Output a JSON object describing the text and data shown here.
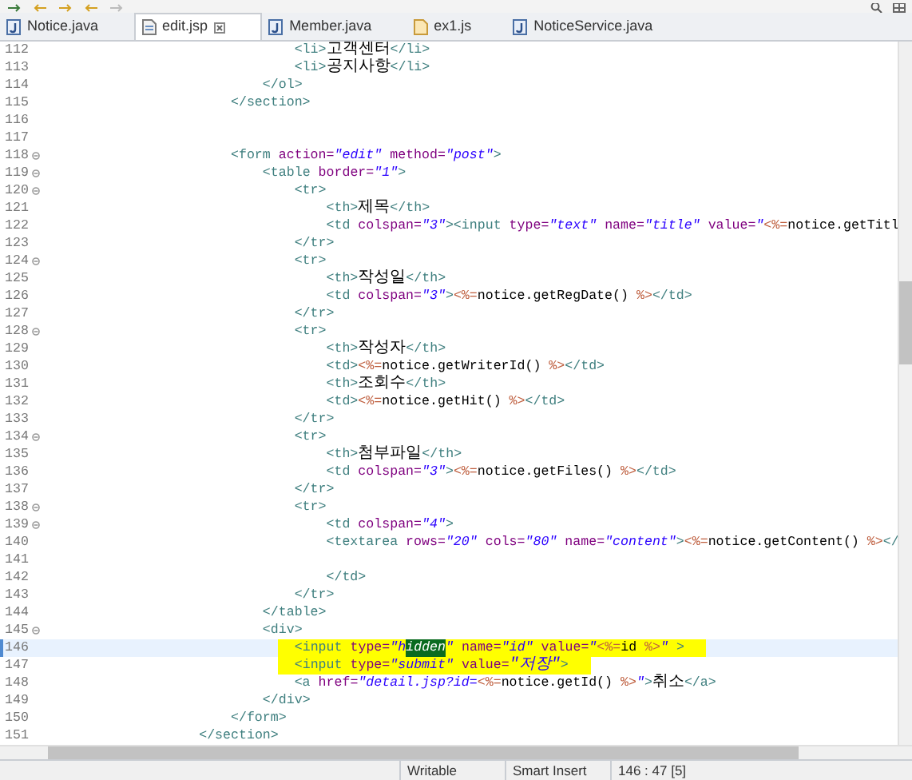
{
  "tabs": [
    {
      "label": "Notice.java",
      "kind": "java",
      "selected": false
    },
    {
      "label": "edit.jsp",
      "kind": "jsp",
      "selected": true
    },
    {
      "label": "Member.java",
      "kind": "java",
      "selected": false
    },
    {
      "label": "ex1.js",
      "kind": "js",
      "selected": false
    },
    {
      "label": "NoticeService.java",
      "kind": "java",
      "selected": false
    }
  ],
  "editor": {
    "lines": [
      {
        "number": "112",
        "fold": false,
        "current": false,
        "marked": false,
        "tokens": [
          {
            "kind": "tag",
            "text": "                                <li>"
          },
          {
            "kind": "text",
            "text": "고객센터"
          },
          {
            "kind": "tag",
            "text": "</li>"
          }
        ]
      },
      {
        "number": "113",
        "fold": false,
        "current": false,
        "marked": false,
        "tokens": [
          {
            "kind": "tag",
            "text": "                                <li>"
          },
          {
            "kind": "text",
            "text": "공지사항"
          },
          {
            "kind": "tag",
            "text": "</li>"
          }
        ]
      },
      {
        "number": "114",
        "fold": false,
        "current": false,
        "marked": false,
        "tokens": [
          {
            "kind": "tag",
            "text": "                            </ol>"
          }
        ]
      },
      {
        "number": "115",
        "fold": false,
        "current": false,
        "marked": false,
        "tokens": [
          {
            "kind": "tag",
            "text": "                        </section>"
          }
        ]
      },
      {
        "number": "116",
        "fold": false,
        "current": false,
        "marked": false
      },
      {
        "number": "117",
        "fold": false,
        "current": false,
        "marked": false
      },
      {
        "number": "118",
        "fold": true,
        "current": false,
        "marked": false,
        "tokens": [
          {
            "kind": "tag",
            "text": "                        <form"
          },
          {
            "kind": "attr",
            "text": " action="
          },
          {
            "kind": "str",
            "text": "\"edit\""
          },
          {
            "kind": "attr",
            "text": " method="
          },
          {
            "kind": "str",
            "text": "\"post\""
          },
          {
            "kind": "tag",
            "text": ">"
          }
        ]
      },
      {
        "number": "119",
        "fold": true,
        "current": false,
        "marked": false,
        "tokens": [
          {
            "kind": "tag",
            "text": "                            <table"
          },
          {
            "kind": "attr",
            "text": " border="
          },
          {
            "kind": "str",
            "text": "\"1\""
          },
          {
            "kind": "tag",
            "text": ">"
          }
        ]
      },
      {
        "number": "120",
        "fold": true,
        "current": false,
        "marked": false,
        "tokens": [
          {
            "kind": "tag",
            "text": "                                <tr>"
          }
        ]
      },
      {
        "number": "121",
        "fold": false,
        "current": false,
        "marked": false,
        "tokens": [
          {
            "kind": "tag",
            "text": "                                    <th>"
          },
          {
            "kind": "text",
            "text": "제목"
          },
          {
            "kind": "tag",
            "text": "</th>"
          }
        ]
      },
      {
        "number": "122",
        "fold": false,
        "current": false,
        "marked": false,
        "tokens": [
          {
            "kind": "tag",
            "text": "                                    <td"
          },
          {
            "kind": "attr",
            "text": " colspan="
          },
          {
            "kind": "str",
            "text": "\"3\""
          },
          {
            "kind": "tag",
            "text": "><input"
          },
          {
            "kind": "attr",
            "text": " type="
          },
          {
            "kind": "str",
            "text": "\"text\""
          },
          {
            "kind": "attr",
            "text": " name="
          },
          {
            "kind": "str",
            "text": "\"title\""
          },
          {
            "kind": "attr",
            "text": " value="
          },
          {
            "kind": "str",
            "text": "\""
          },
          {
            "kind": "jsp",
            "text": "<%="
          },
          {
            "kind": "text",
            "text": "notice.getTitl"
          }
        ]
      },
      {
        "number": "123",
        "fold": false,
        "current": false,
        "marked": false,
        "tokens": [
          {
            "kind": "tag",
            "text": "                                </tr>"
          }
        ]
      },
      {
        "number": "124",
        "fold": true,
        "current": false,
        "marked": false,
        "tokens": [
          {
            "kind": "tag",
            "text": "                                <tr>"
          }
        ]
      },
      {
        "number": "125",
        "fold": false,
        "current": false,
        "marked": false,
        "tokens": [
          {
            "kind": "tag",
            "text": "                                    <th>"
          },
          {
            "kind": "text",
            "text": "작성일"
          },
          {
            "kind": "tag",
            "text": "</th>"
          }
        ]
      },
      {
        "number": "126",
        "fold": false,
        "current": false,
        "marked": false,
        "tokens": [
          {
            "kind": "tag",
            "text": "                                    <td"
          },
          {
            "kind": "attr",
            "text": " colspan="
          },
          {
            "kind": "str",
            "text": "\"3\""
          },
          {
            "kind": "tag",
            "text": ">"
          },
          {
            "kind": "jsp",
            "text": "<%="
          },
          {
            "kind": "text",
            "text": "notice.getRegDate() "
          },
          {
            "kind": "jsp",
            "text": "%>"
          },
          {
            "kind": "tag",
            "text": "</td>"
          }
        ]
      },
      {
        "number": "127",
        "fold": false,
        "current": false,
        "marked": false,
        "tokens": [
          {
            "kind": "tag",
            "text": "                                </tr>"
          }
        ]
      },
      {
        "number": "128",
        "fold": true,
        "current": false,
        "marked": false,
        "tokens": [
          {
            "kind": "tag",
            "text": "                                <tr>"
          }
        ]
      },
      {
        "number": "129",
        "fold": false,
        "current": false,
        "marked": false,
        "tokens": [
          {
            "kind": "tag",
            "text": "                                    <th>"
          },
          {
            "kind": "text",
            "text": "작성자"
          },
          {
            "kind": "tag",
            "text": "</th>"
          }
        ]
      },
      {
        "number": "130",
        "fold": false,
        "current": false,
        "marked": false,
        "tokens": [
          {
            "kind": "tag",
            "text": "                                    <td>"
          },
          {
            "kind": "jsp",
            "text": "<%="
          },
          {
            "kind": "text",
            "text": "notice.getWriterId() "
          },
          {
            "kind": "jsp",
            "text": "%>"
          },
          {
            "kind": "tag",
            "text": "</td>"
          }
        ]
      },
      {
        "number": "131",
        "fold": false,
        "current": false,
        "marked": false,
        "tokens": [
          {
            "kind": "tag",
            "text": "                                    <th>"
          },
          {
            "kind": "text",
            "text": "조회수"
          },
          {
            "kind": "tag",
            "text": "</th>"
          }
        ]
      },
      {
        "number": "132",
        "fold": false,
        "current": false,
        "marked": false,
        "tokens": [
          {
            "kind": "tag",
            "text": "                                    <td>"
          },
          {
            "kind": "jsp",
            "text": "<%="
          },
          {
            "kind": "text",
            "text": "notice.getHit() "
          },
          {
            "kind": "jsp",
            "text": "%>"
          },
          {
            "kind": "tag",
            "text": "</td>"
          }
        ]
      },
      {
        "number": "133",
        "fold": false,
        "current": false,
        "marked": false,
        "tokens": [
          {
            "kind": "tag",
            "text": "                                </tr>"
          }
        ]
      },
      {
        "number": "134",
        "fold": true,
        "current": false,
        "marked": false,
        "tokens": [
          {
            "kind": "tag",
            "text": "                                <tr>"
          }
        ]
      },
      {
        "number": "135",
        "fold": false,
        "current": false,
        "marked": false,
        "tokens": [
          {
            "kind": "tag",
            "text": "                                    <th>"
          },
          {
            "kind": "text",
            "text": "첨부파일"
          },
          {
            "kind": "tag",
            "text": "</th>"
          }
        ]
      },
      {
        "number": "136",
        "fold": false,
        "current": false,
        "marked": false,
        "tokens": [
          {
            "kind": "tag",
            "text": "                                    <td"
          },
          {
            "kind": "attr",
            "text": " colspan="
          },
          {
            "kind": "str",
            "text": "\"3\""
          },
          {
            "kind": "tag",
            "text": ">"
          },
          {
            "kind": "jsp",
            "text": "<%="
          },
          {
            "kind": "text",
            "text": "notice.getFiles() "
          },
          {
            "kind": "jsp",
            "text": "%>"
          },
          {
            "kind": "tag",
            "text": "</td>"
          }
        ]
      },
      {
        "number": "137",
        "fold": false,
        "current": false,
        "marked": false,
        "tokens": [
          {
            "kind": "tag",
            "text": "                                </tr>"
          }
        ]
      },
      {
        "number": "138",
        "fold": true,
        "current": false,
        "marked": false,
        "tokens": [
          {
            "kind": "tag",
            "text": "                                <tr>"
          }
        ]
      },
      {
        "number": "139",
        "fold": true,
        "current": false,
        "marked": false,
        "tokens": [
          {
            "kind": "tag",
            "text": "                                    <td"
          },
          {
            "kind": "attr",
            "text": " colspan="
          },
          {
            "kind": "str",
            "text": "\"4\""
          },
          {
            "kind": "tag",
            "text": ">"
          }
        ]
      },
      {
        "number": "140",
        "fold": false,
        "current": false,
        "marked": false,
        "tokens": [
          {
            "kind": "tag",
            "text": "                                    <textarea"
          },
          {
            "kind": "attr",
            "text": " rows="
          },
          {
            "kind": "str",
            "text": "\"20\""
          },
          {
            "kind": "attr",
            "text": " cols="
          },
          {
            "kind": "str",
            "text": "\"80\""
          },
          {
            "kind": "attr",
            "text": " name="
          },
          {
            "kind": "str",
            "text": "\"content\""
          },
          {
            "kind": "tag",
            "text": ">"
          },
          {
            "kind": "jsp",
            "text": "<%="
          },
          {
            "kind": "text",
            "text": "notice.getContent() "
          },
          {
            "kind": "jsp",
            "text": "%>"
          },
          {
            "kind": "tag",
            "text": "</"
          }
        ]
      },
      {
        "number": "141",
        "fold": false,
        "current": false,
        "marked": false
      },
      {
        "number": "142",
        "fold": false,
        "current": false,
        "marked": false,
        "tokens": [
          {
            "kind": "tag",
            "text": "                                    </td>"
          }
        ]
      },
      {
        "number": "143",
        "fold": false,
        "current": false,
        "marked": false,
        "tokens": [
          {
            "kind": "tag",
            "text": "                                </tr>"
          }
        ]
      },
      {
        "number": "144",
        "fold": false,
        "current": false,
        "marked": false,
        "tokens": [
          {
            "kind": "tag",
            "text": "                            </table>"
          }
        ]
      },
      {
        "number": "145",
        "fold": true,
        "current": false,
        "marked": false,
        "tokens": [
          {
            "kind": "tag",
            "text": "                            <div>"
          }
        ]
      },
      {
        "number": "146",
        "fold": false,
        "current": true,
        "marked": true,
        "tokens": [
          {
            "kind": "tag",
            "text": "                                <input"
          },
          {
            "kind": "attr",
            "text": " type="
          },
          {
            "kind": "str",
            "text": "\"h"
          },
          {
            "kind": "selected",
            "text": "idden"
          },
          {
            "kind": "str",
            "text": "\""
          },
          {
            "kind": "attr",
            "text": " name="
          },
          {
            "kind": "str",
            "text": "\"id\""
          },
          {
            "kind": "attr",
            "text": " value="
          },
          {
            "kind": "str",
            "text": "\""
          },
          {
            "kind": "jsp",
            "text": "<%="
          },
          {
            "kind": "text",
            "text": "id "
          },
          {
            "kind": "jsp",
            "text": "%>"
          },
          {
            "kind": "str",
            "text": "\""
          },
          {
            "kind": "tag",
            "text": " >"
          }
        ]
      },
      {
        "number": "147",
        "fold": false,
        "current": false,
        "marked": true,
        "tokens": [
          {
            "kind": "tag",
            "text": "                                <input"
          },
          {
            "kind": "attr",
            "text": " type="
          },
          {
            "kind": "str",
            "text": "\"submit\""
          },
          {
            "kind": "attr",
            "text": " value="
          },
          {
            "kind": "str",
            "text": "\"저장\""
          },
          {
            "kind": "tag",
            "text": ">"
          }
        ]
      },
      {
        "number": "148",
        "fold": false,
        "current": false,
        "marked": false,
        "tokens": [
          {
            "kind": "tag",
            "text": "                                <a"
          },
          {
            "kind": "attr",
            "text": " href="
          },
          {
            "kind": "str",
            "text": "\"detail.jsp?id="
          },
          {
            "kind": "jsp",
            "text": "<%="
          },
          {
            "kind": "text",
            "text": "notice.getId() "
          },
          {
            "kind": "jsp",
            "text": "%>"
          },
          {
            "kind": "str",
            "text": "\""
          },
          {
            "kind": "tag",
            "text": ">"
          },
          {
            "kind": "text",
            "text": "취소"
          },
          {
            "kind": "tag",
            "text": "</a>"
          }
        ]
      },
      {
        "number": "149",
        "fold": false,
        "current": false,
        "marked": false,
        "tokens": [
          {
            "kind": "tag",
            "text": "                            </div>"
          }
        ]
      },
      {
        "number": "150",
        "fold": false,
        "current": false,
        "marked": false,
        "tokens": [
          {
            "kind": "tag",
            "text": "                        </form>"
          }
        ]
      },
      {
        "number": "151",
        "fold": false,
        "current": false,
        "marked": false,
        "tokens": [
          {
            "kind": "tag",
            "text": "                    </section>"
          }
        ]
      }
    ]
  },
  "status_bar": [
    "Writable",
    "Smart Insert",
    "146 : 47 [5]"
  ]
}
